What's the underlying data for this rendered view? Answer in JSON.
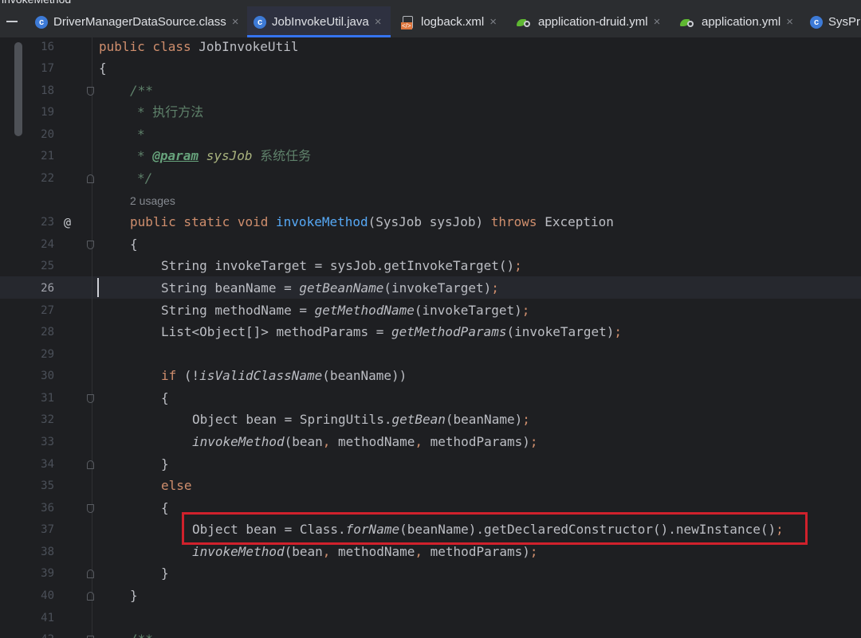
{
  "top_crumb": "invokeMethod",
  "tabs": [
    {
      "label": "DriverManagerDataSource.class",
      "icon": "class-icon"
    },
    {
      "label": "JobInvokeUtil.java",
      "icon": "class-icon",
      "active": true
    },
    {
      "label": "logback.xml",
      "icon": "xml-icon"
    },
    {
      "label": "application-druid.yml",
      "icon": "spring-yaml-icon"
    },
    {
      "label": "application.yml",
      "icon": "spring-yaml-icon"
    },
    {
      "label": "SysPr",
      "icon": "class-icon"
    }
  ],
  "gutter": {
    "line_numbers": [
      "16",
      "17",
      "18",
      "19",
      "20",
      "21",
      "22",
      "",
      "23",
      "24",
      "25",
      "26",
      "27",
      "28",
      "29",
      "30",
      "31",
      "32",
      "33",
      "34",
      "35",
      "36",
      "37",
      "38",
      "39",
      "40",
      "41",
      "42"
    ],
    "current_line": "26",
    "override_marker": "@"
  },
  "code": {
    "l16": {
      "kw": "public class ",
      "name": "JobInvokeUtil"
    },
    "l17": "{",
    "l18": "/**",
    "l19": "* 执行方法",
    "l20": "*",
    "l21": {
      "star": "* ",
      "tag": "@param",
      "param": " sysJob ",
      "desc": "系统任务"
    },
    "l22": "*/",
    "usages": "2 usages",
    "l23": {
      "kw": "public static void ",
      "fn": "invokeMethod",
      "args": "(SysJob sysJob) ",
      "throws": "throws ",
      "exc": "Exception"
    },
    "l24": "{",
    "l25": {
      "a": "String invokeTarget = sysJob.getInvokeTarget()",
      "semi": ";"
    },
    "l26": {
      "a": "String beanName = ",
      "it": "getBeanName",
      "b": "(invokeTarget)",
      "semi": ";"
    },
    "l27": {
      "a": "String methodName = ",
      "it": "getMethodName",
      "b": "(invokeTarget)",
      "semi": ";"
    },
    "l28": {
      "a": "List<Object[]> methodParams = ",
      "it": "getMethodParams",
      "b": "(invokeTarget)",
      "semi": ";"
    },
    "l30": {
      "kw": "if ",
      "a": "(!",
      "it": "isValidClassName",
      "b": "(beanName))"
    },
    "l31": "{",
    "l32": {
      "a": "Object bean = SpringUtils.",
      "it": "getBean",
      "b": "(beanName)",
      "semi": ";"
    },
    "l33": {
      "it": "invokeMethod",
      "a": "(bean",
      "c1": ",",
      "b": " methodName",
      "c2": ",",
      "d": " methodParams)",
      "semi": ";"
    },
    "l34": "}",
    "l35": "else",
    "l36": "{",
    "l37": {
      "a": "Object bean = Class.",
      "it": "forName",
      "b": "(beanName).getDeclaredConstructor().newInstance()",
      "semi": ";"
    },
    "l38": {
      "it": "invokeMethod",
      "a": "(bean",
      "c1": ",",
      "b": " methodName",
      "c2": ",",
      "d": " methodParams)",
      "semi": ";"
    },
    "l39": "}",
    "l40": "}",
    "l42": "/**"
  },
  "colors": {
    "keyword": "#cf8e6d",
    "function": "#56a8f5",
    "comment": "#5f826b",
    "highlight_box": "#d0212c",
    "tab_underline": "#3574f0"
  }
}
